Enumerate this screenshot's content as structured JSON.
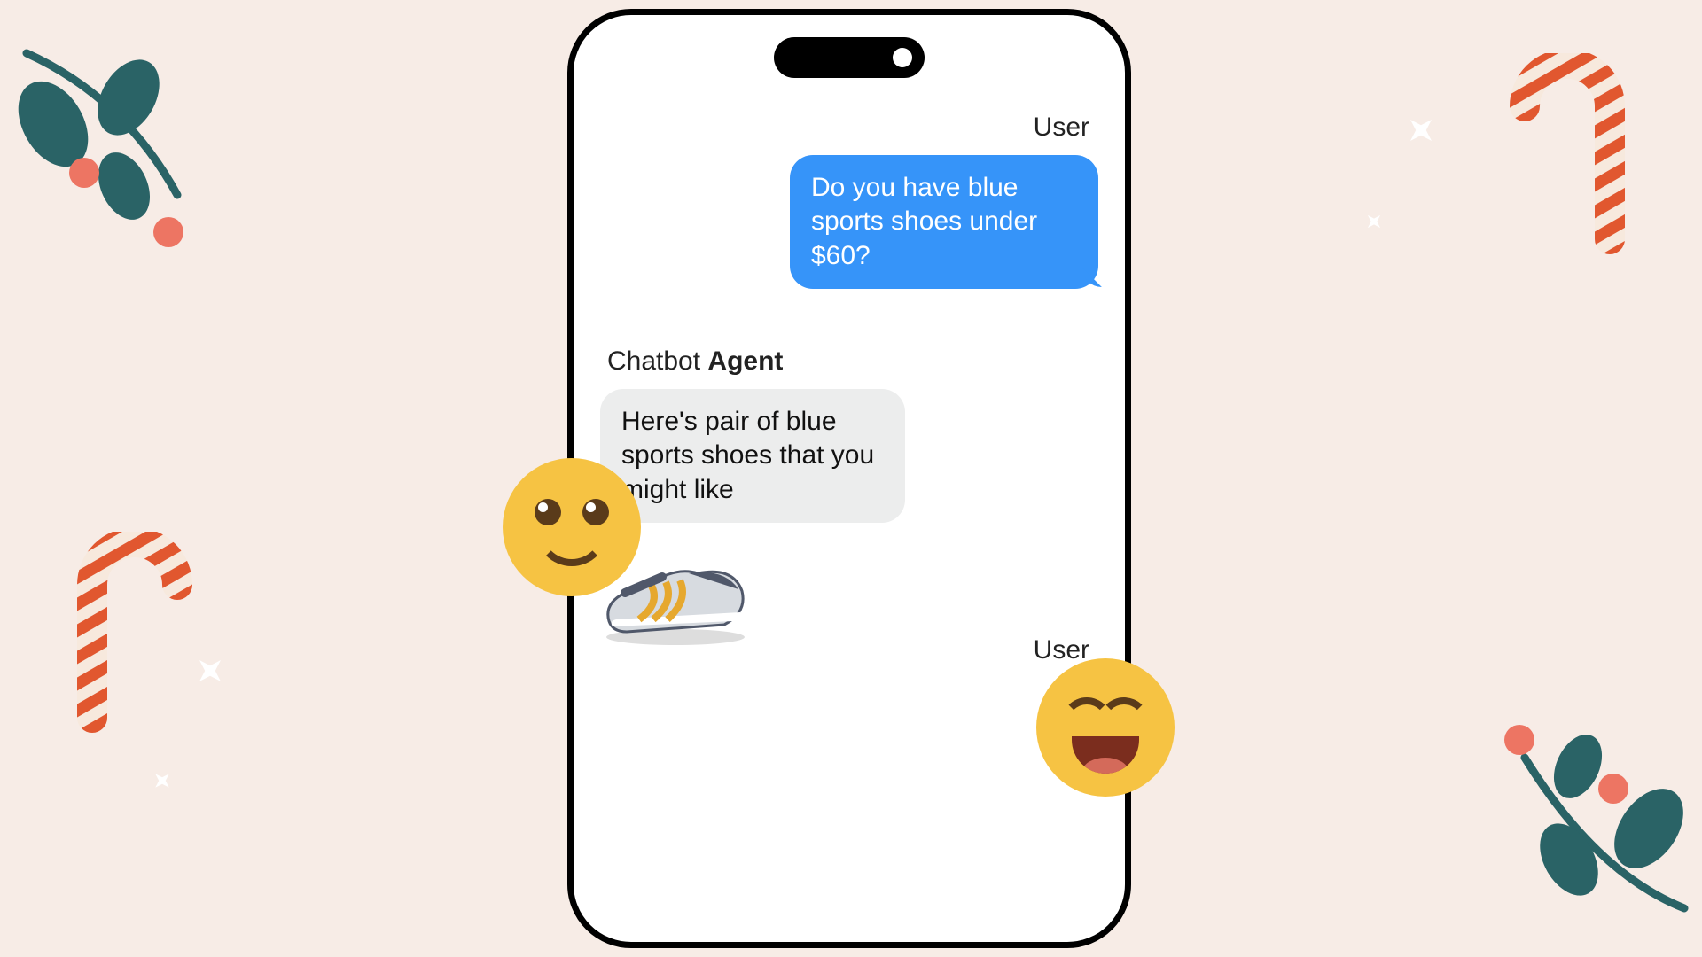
{
  "chat": {
    "user_label": "User",
    "agent_label_prefix": "Chatbot ",
    "agent_label_bold": "Agent",
    "user_message": "Do you have blue sports shoes under $60?",
    "agent_message": "Here's pair of blue sports shoes that you might like",
    "user_label_2": "User"
  },
  "icons": {
    "smile_emoji": "smile-emoji",
    "laugh_emoji": "laugh-emoji",
    "shoe": "sneaker-image",
    "candy_cane": "candy-cane-icon",
    "holly": "holly-branch-icon",
    "sparkle": "sparkle-icon"
  },
  "colors": {
    "background": "#f7ece6",
    "user_bubble": "#3694f9",
    "agent_bubble": "#eceded",
    "emoji": "#f6c343",
    "holly_leaf": "#2a6366",
    "holly_berry": "#ed7563",
    "cane_red": "#e1572f"
  }
}
